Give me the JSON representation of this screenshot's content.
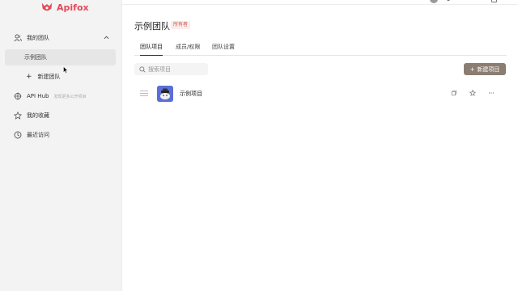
{
  "app": {
    "name": "Apifox",
    "brand_color": "#e24b5a"
  },
  "sidebar": {
    "my_teams": {
      "label": "我的团队",
      "icon": "users-icon",
      "chevron": "chevron-up-icon"
    },
    "teams": [
      {
        "label": "示例团队",
        "active": true
      }
    ],
    "new_team": {
      "label": "新建团队"
    },
    "api_hub": {
      "label": "API Hub",
      "hint": "发现更多公开项目",
      "icon": "hub-icon"
    },
    "favorites": {
      "label": "我的收藏",
      "icon": "star-icon"
    },
    "recent": {
      "label": "最近访问",
      "icon": "clock-icon"
    }
  },
  "main": {
    "title": "示例团队",
    "badge": "所有者",
    "tabs": [
      {
        "label": "团队项目",
        "active": true
      },
      {
        "label": "成员/权限",
        "active": false
      },
      {
        "label": "团队设置",
        "active": false
      }
    ],
    "search": {
      "placeholder": "搜索项目",
      "value": ""
    },
    "new_project": {
      "label": "新建项目",
      "color": "#8b7d72"
    },
    "projects": [
      {
        "name": "示例项目",
        "icon_color": "#5b6fd6"
      }
    ]
  }
}
